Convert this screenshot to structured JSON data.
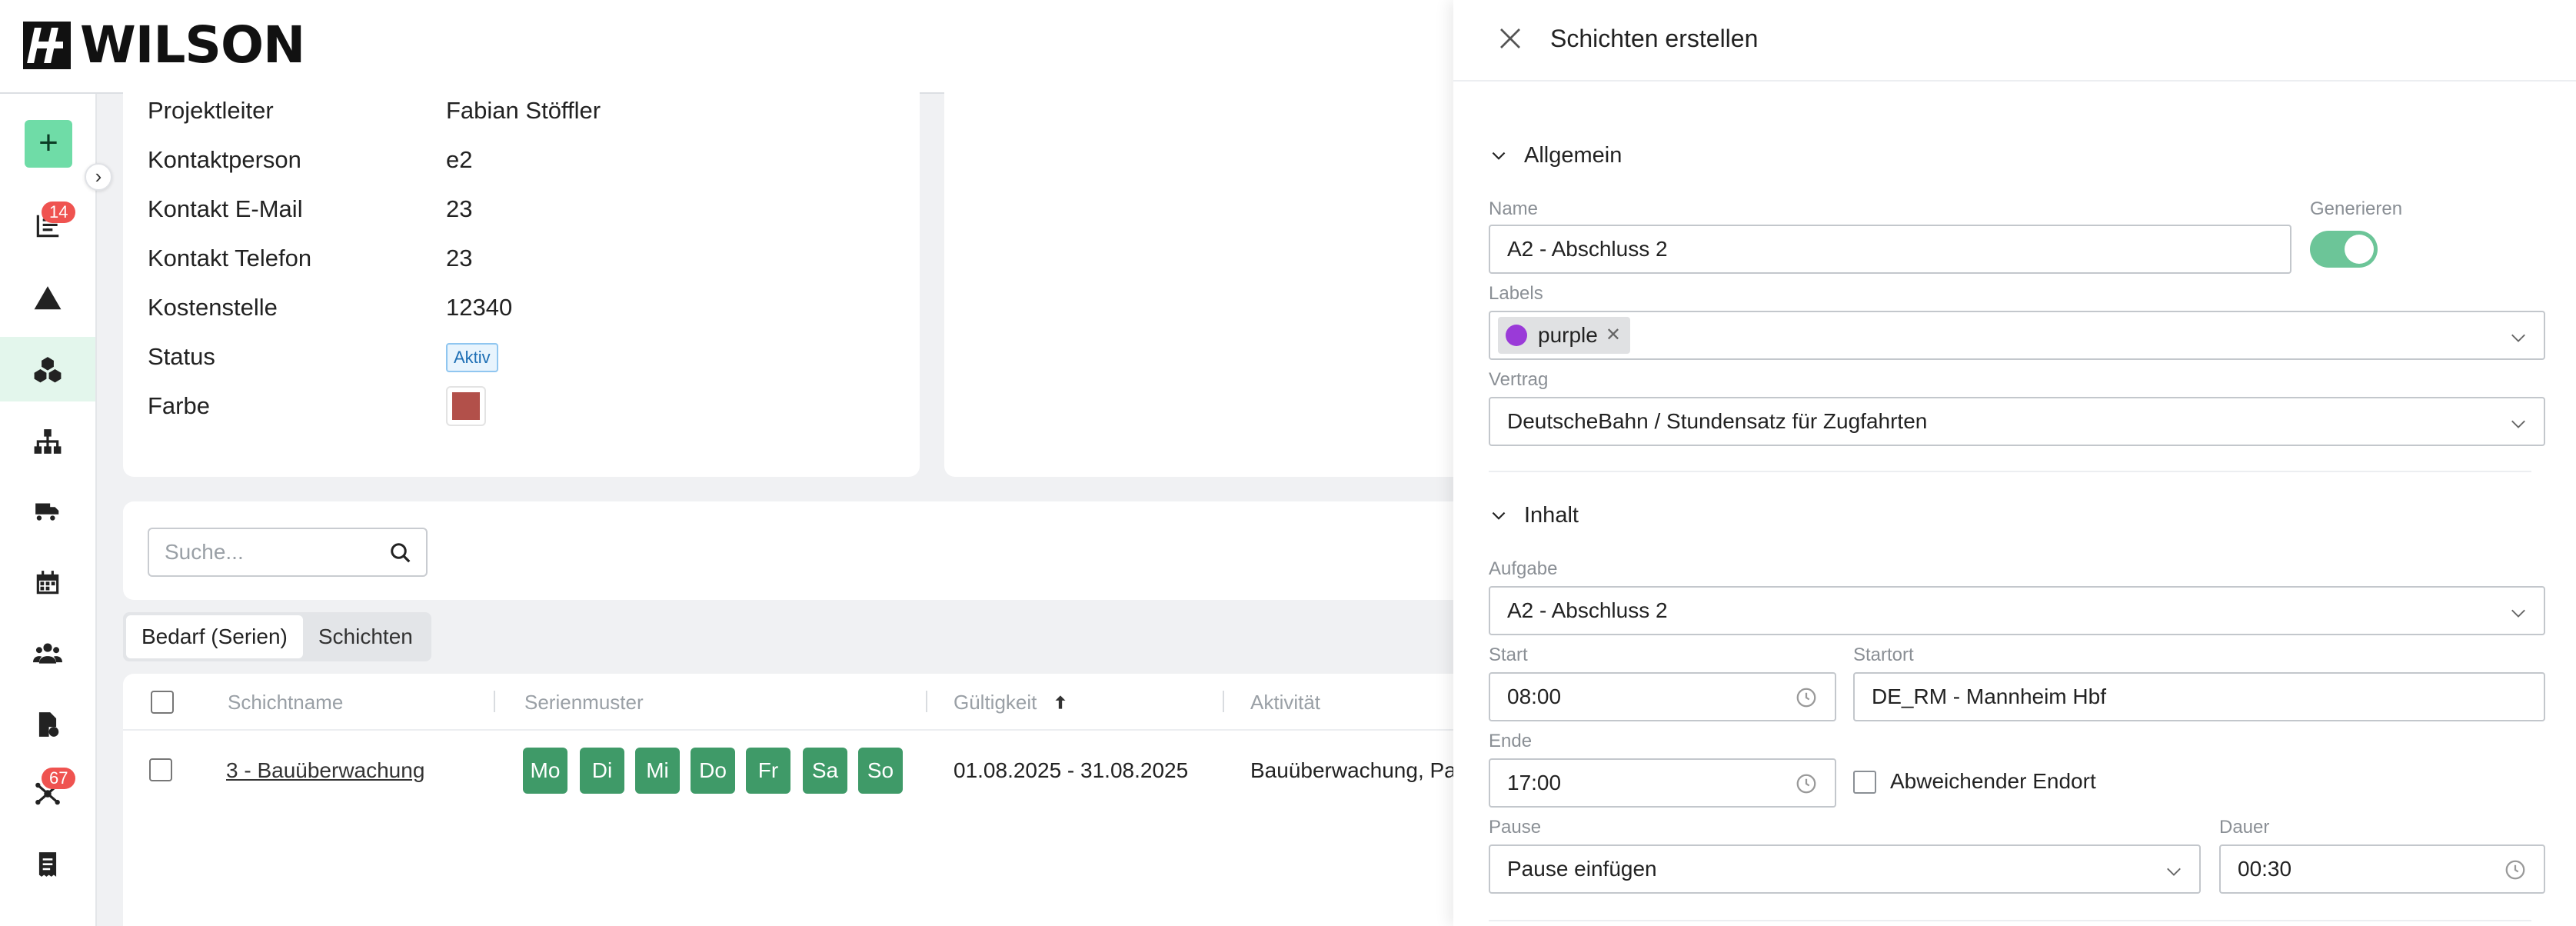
{
  "brand": {
    "logo_text": "WILSON"
  },
  "sidebar": {
    "add_label": "+",
    "collapse_label": "›",
    "items": [
      {
        "name": "reports",
        "badge": "14"
      },
      {
        "name": "warnings",
        "badge": ""
      },
      {
        "name": "projects",
        "badge": "",
        "active": true
      },
      {
        "name": "structure",
        "badge": ""
      },
      {
        "name": "vehicles",
        "badge": ""
      },
      {
        "name": "calendar",
        "badge": ""
      },
      {
        "name": "people",
        "badge": ""
      },
      {
        "name": "documents",
        "badge": ""
      },
      {
        "name": "connections",
        "badge": "67"
      },
      {
        "name": "invoices",
        "badge": ""
      }
    ]
  },
  "info": {
    "rows": [
      {
        "label": "Projektleiter",
        "value": "Fabian Stöffler"
      },
      {
        "label": "Kontaktperson",
        "value": "e2"
      },
      {
        "label": "Kontakt E-Mail",
        "value": "23"
      },
      {
        "label": "Kontakt Telefon",
        "value": "23"
      },
      {
        "label": "Kostenstelle",
        "value": "12340"
      },
      {
        "label": "Status",
        "value": ""
      },
      {
        "label": "Farbe",
        "value": ""
      }
    ],
    "status_tag": "Aktiv",
    "farbe_color": "#b2504a"
  },
  "search": {
    "placeholder": "Suche..."
  },
  "tabs": [
    {
      "label": "Bedarf (Serien)",
      "active": true
    },
    {
      "label": "Schichten",
      "active": false
    }
  ],
  "table": {
    "columns": [
      "Schichtname",
      "Serienmuster",
      "Gültigkeit",
      "Aktivität"
    ],
    "rows": [
      {
        "name": "3 - Bauüberwachung",
        "days": [
          "Mo",
          "Di",
          "Mi",
          "Do",
          "Fr",
          "Sa",
          "So"
        ],
        "validity": "01.08.2025 - 31.08.2025",
        "activity": "Bauüberwachung, Pa"
      }
    ]
  },
  "panel": {
    "title": "Schichten erstellen",
    "sections": {
      "general": "Allgemein",
      "content": "Inhalt"
    },
    "name_label": "Name",
    "name_value": "A2 - Abschluss 2",
    "generate_label": "Generieren",
    "generate_on": true,
    "labels_label": "Labels",
    "label_chip": "purple",
    "label_chip_color": "#9a3ad8",
    "contract_label": "Vertrag",
    "contract_value": "DeutscheBahn / Stundensatz für Zugfahrten",
    "task_label": "Aufgabe",
    "task_value": "A2 - Abschluss 2",
    "start_label": "Start",
    "start_value": "08:00",
    "start_place_label": "Startort",
    "start_place_value": "DE_RM - Mannheim Hbf",
    "end_label": "Ende",
    "end_value": "17:00",
    "diff_end_label": "Abweichender Endort",
    "pause_label": "Pause",
    "pause_value": "Pause einfügen",
    "duration_label": "Dauer",
    "duration_value": "00:30"
  }
}
